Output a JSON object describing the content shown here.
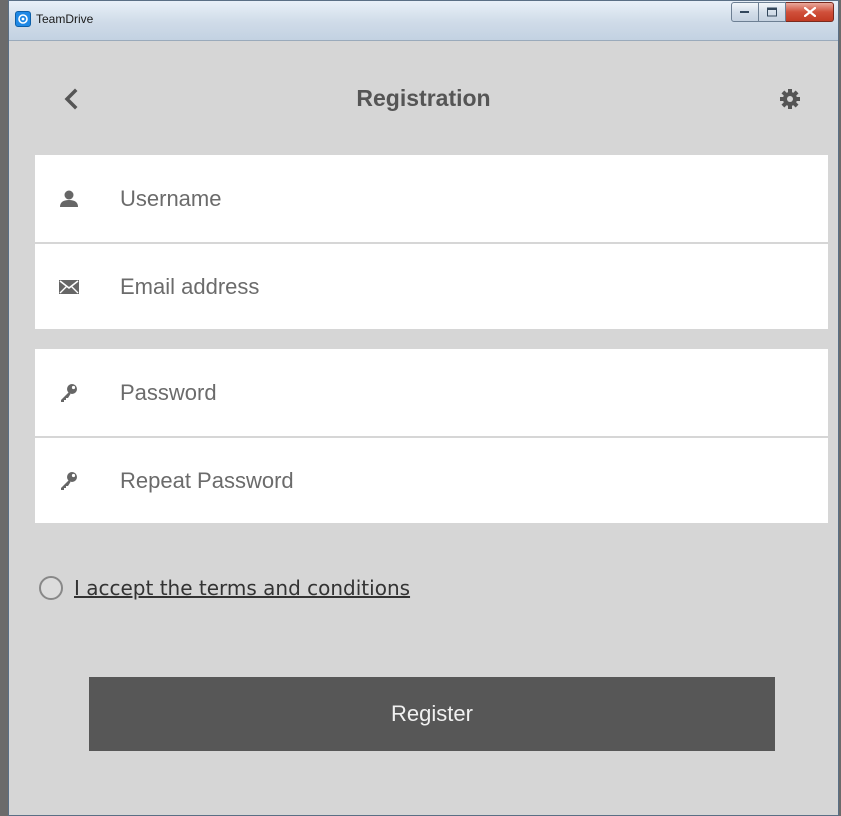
{
  "window": {
    "title": "TeamDrive",
    "app_icon": "teamdrive-logo-icon",
    "controls": [
      "minimize-icon",
      "maximize-icon",
      "close-icon"
    ]
  },
  "header": {
    "title": "Registration",
    "back_icon": "chevron-left-icon",
    "settings_icon": "gear-icon"
  },
  "form": {
    "account_fields": [
      {
        "icon": "user-icon",
        "placeholder": "Username",
        "value": ""
      },
      {
        "icon": "envelope-icon",
        "placeholder": "Email address",
        "value": ""
      }
    ],
    "password_fields": [
      {
        "icon": "key-icon",
        "placeholder": "Password",
        "value": ""
      },
      {
        "icon": "key-icon",
        "placeholder": "Repeat Password",
        "value": ""
      }
    ]
  },
  "terms": {
    "label": "I accept the terms and conditions",
    "checked": false
  },
  "register": {
    "label": "Register"
  },
  "colors": {
    "background": "#d6d6d6",
    "field_background": "#ffffff",
    "button_background": "#575757",
    "title_text": "#555555",
    "icon": "#666666"
  }
}
